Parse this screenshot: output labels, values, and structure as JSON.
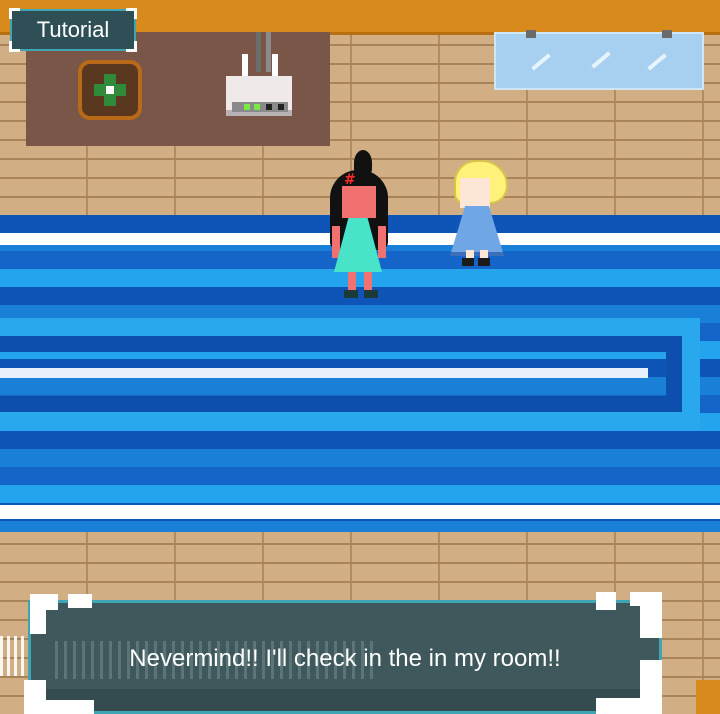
{
  "hud": {
    "tutorial_label": "Tutorial"
  },
  "dialogue": {
    "text": "Nevermind!! I'll check in the in my room!!"
  },
  "scene": {
    "objects": [
      "wall-panel",
      "potted-plant",
      "wifi-router",
      "window",
      "blue-striped-rug"
    ],
    "characters": [
      "dark-haired-girl-angry",
      "blonde-girl-blue-dress"
    ]
  },
  "colors": {
    "accent_border": "#3fa4b3",
    "panel_bg": "#3e585c",
    "trim_orange": "#d98a1c",
    "rug_blue_dark": "#0f55b8",
    "rug_blue_light": "#23a4ec",
    "wood": "#d1ae84"
  }
}
